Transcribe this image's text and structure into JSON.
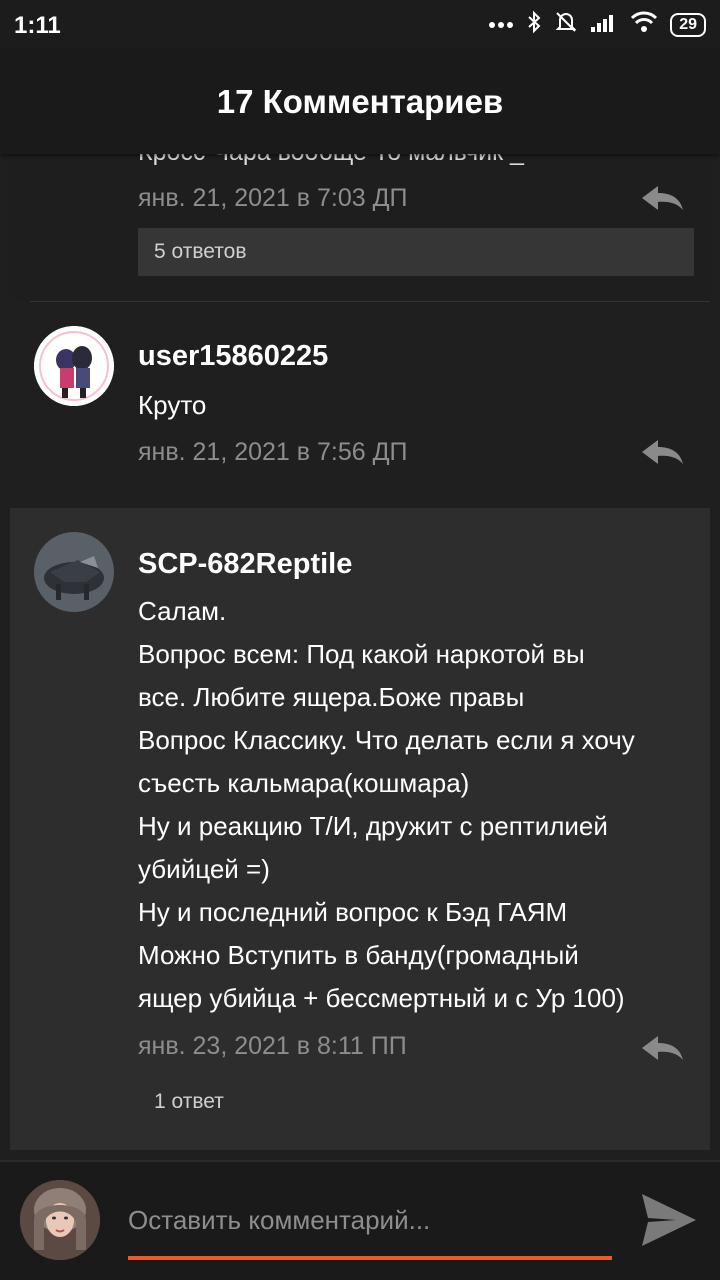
{
  "status_bar": {
    "time": "1:11",
    "battery": "29"
  },
  "header": {
    "title": "17 Комментариев"
  },
  "comments": [
    {
      "partial_text": "Кросс  Чара вообще  То мальчик  _",
      "timestamp": "янв. 21, 2021 в 7:03 ДП",
      "replies_label": "5 ответов"
    },
    {
      "username": "user15860225",
      "text": "Круто",
      "timestamp": "янв. 21, 2021 в 7:56 ДП"
    },
    {
      "username": "SCP-682Reptile",
      "lines": [
        "Салам.",
        "Вопрос всем: Под какой наркотой вы",
        "все. Любите ящера.Боже правы",
        "Вопрос Классику. Что делать если я хочу",
        "съесть кальмара(кошмара)",
        "Ну и реакцию Т/И, дружит с рептилией",
        "убийцей =)",
        "Ну и последний вопрос к Бэд ГАЯМ",
        "Можно Вступить в банду(громадный",
        "ящер убийца + бессмертный и с Ур 100)"
      ],
      "timestamp": "янв. 23, 2021 в 8:11 ПП",
      "replies_label": "1 ответ"
    }
  ],
  "compose": {
    "placeholder": "Оставить комментарий..."
  },
  "colors": {
    "accent": "#f05a2a",
    "timestamp": "#8d8d8d",
    "highlight_bg": "#2d2d2e"
  }
}
